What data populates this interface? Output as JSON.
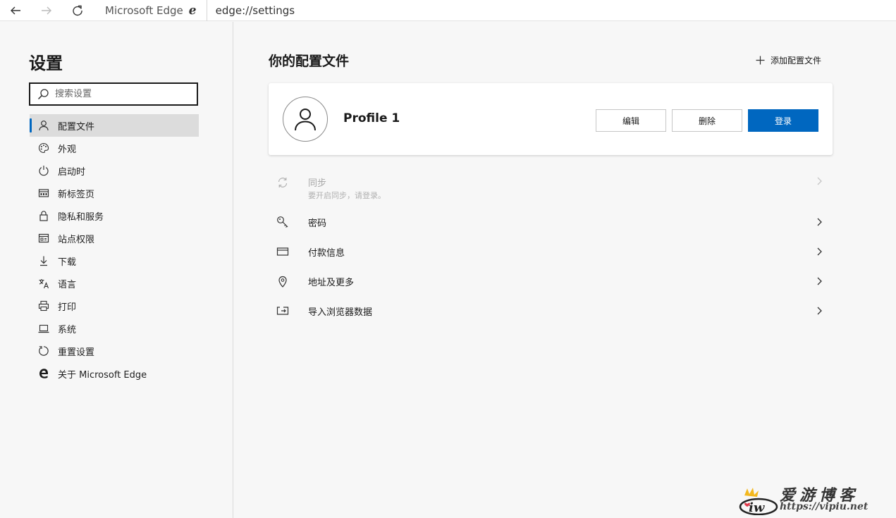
{
  "browser": {
    "site_name": "Microsoft Edge",
    "url": "edge://settings"
  },
  "sidebar": {
    "title": "设置",
    "search_placeholder": "搜索设置",
    "items": [
      {
        "label": "配置文件",
        "icon": "person-icon",
        "active": true
      },
      {
        "label": "外观",
        "icon": "palette-icon"
      },
      {
        "label": "启动时",
        "icon": "power-icon"
      },
      {
        "label": "新标签页",
        "icon": "newtab-icon"
      },
      {
        "label": "隐私和服务",
        "icon": "lock-icon"
      },
      {
        "label": "站点权限",
        "icon": "site-permissions-icon"
      },
      {
        "label": "下载",
        "icon": "download-icon"
      },
      {
        "label": "语言",
        "icon": "language-icon"
      },
      {
        "label": "打印",
        "icon": "printer-icon"
      },
      {
        "label": "系统",
        "icon": "laptop-icon"
      },
      {
        "label": "重置设置",
        "icon": "reset-icon"
      },
      {
        "label": "关于 Microsoft Edge",
        "icon": "edge-logo-icon"
      }
    ]
  },
  "main": {
    "title": "你的配置文件",
    "add_profile_label": "添加配置文件",
    "profile": {
      "name": "Profile 1",
      "edit_label": "编辑",
      "delete_label": "删除",
      "signin_label": "登录"
    },
    "rows": [
      {
        "label": "同步",
        "sub": "要开启同步，请登录。",
        "icon": "sync-icon",
        "disabled": true
      },
      {
        "label": "密码",
        "icon": "key-icon"
      },
      {
        "label": "付款信息",
        "icon": "card-icon"
      },
      {
        "label": "地址及更多",
        "icon": "location-pin-icon"
      },
      {
        "label": "导入浏览器数据",
        "icon": "import-icon"
      }
    ]
  },
  "watermark": {
    "cn": "爱游博客",
    "url": "https://vipiu.net"
  },
  "colors": {
    "accent": "#0067c0",
    "background": "#f7f7f7"
  }
}
